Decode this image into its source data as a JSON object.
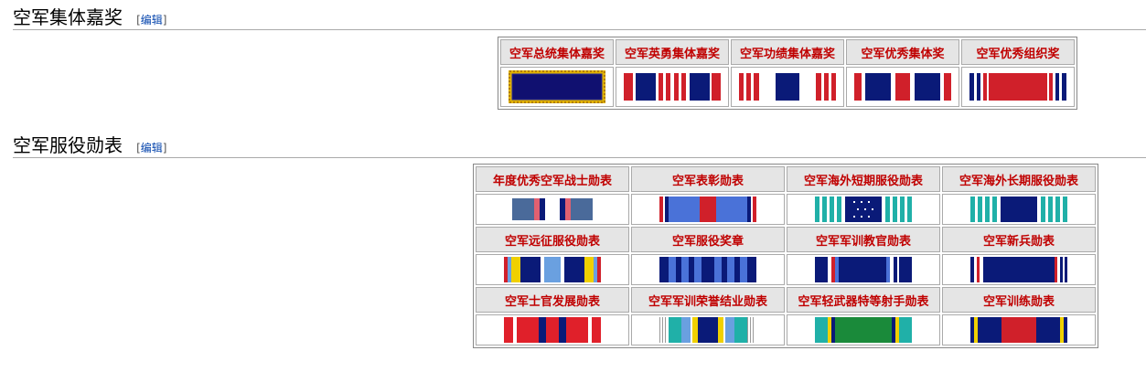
{
  "sections": [
    {
      "title": "空军集体嘉奖",
      "edit_open": "[",
      "edit_label": "编辑",
      "edit_close": "]",
      "awards": [
        {
          "name": "空军总统集体嘉奖",
          "ribbon": "ribbon-presidential-unit-citation"
        },
        {
          "name": "空军英勇集体嘉奖",
          "ribbon": "ribbon-gallant-unit-citation"
        },
        {
          "name": "空军功绩集体嘉奖",
          "ribbon": "ribbon-meritorious-unit-award"
        },
        {
          "name": "空军优秀集体奖",
          "ribbon": "ribbon-outstanding-unit-award"
        },
        {
          "name": "空军优秀组织奖",
          "ribbon": "ribbon-organizational-excellence-award"
        }
      ]
    },
    {
      "title": "空军服役勋表",
      "edit_open": "[",
      "edit_label": "编辑",
      "edit_close": "]",
      "awards": [
        {
          "name": "年度优秀空军战士勋表",
          "ribbon": "ribbon-outstanding-airman-of-year"
        },
        {
          "name": "空军表彰勋表",
          "ribbon": "ribbon-recognition"
        },
        {
          "name": "空军海外短期服役勋表",
          "ribbon": "ribbon-overseas-short-tour"
        },
        {
          "name": "空军海外长期服役勋表",
          "ribbon": "ribbon-overseas-long-tour"
        },
        {
          "name": "空军远征服役勋表",
          "ribbon": "ribbon-expeditionary-service"
        },
        {
          "name": "空军服役奖章",
          "ribbon": "ribbon-longevity-service"
        },
        {
          "name": "空军军训教官勋表",
          "ribbon": "ribbon-military-training-instructor"
        },
        {
          "name": "空军新兵勋表",
          "ribbon": "ribbon-recruiter"
        },
        {
          "name": "空军士官发展勋表",
          "ribbon": "ribbon-nco-professional-development"
        },
        {
          "name": "空军军训荣誉结业勋表",
          "ribbon": "ribbon-basic-training-honor-graduate"
        },
        {
          "name": "空军轻武器特等射手勋表",
          "ribbon": "ribbon-small-arms-expert-marksmanship"
        },
        {
          "name": "空军训练勋表",
          "ribbon": "ribbon-training"
        }
      ]
    }
  ],
  "colors": {
    "heading_rule": "#aaaaaa",
    "award_name": "#c00000",
    "header_bg": "#e5e5e5",
    "edit_link": "#0645ad"
  }
}
